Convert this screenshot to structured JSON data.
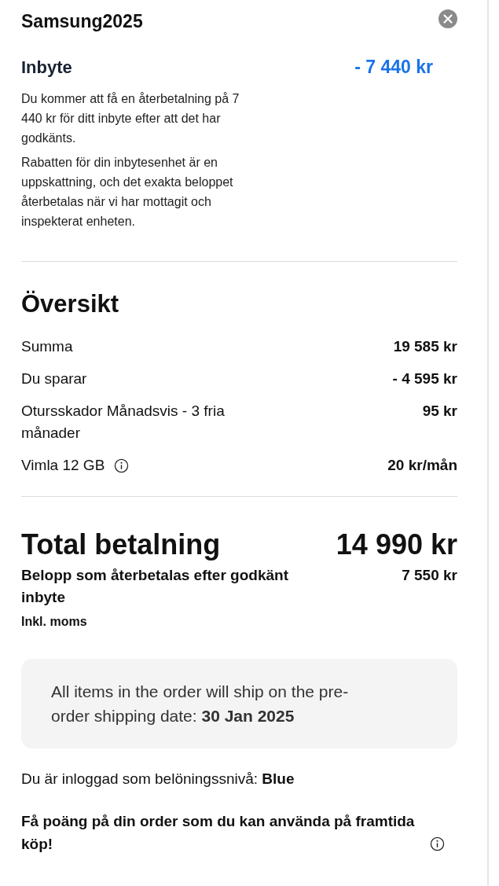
{
  "header": {
    "title": "Samsung2025"
  },
  "trade_in": {
    "title": "Inbyte",
    "amount": "- 7 440 kr",
    "paragraphs": [
      "Du kommer att få en återbetalning på 7 440 kr för ditt inbyte efter att det har godkänts.",
      "Rabatten för din inbytesenhet är en uppskattning, och det exakta beloppet återbetalas när vi har mottagit och inspekterat enheten."
    ]
  },
  "overview": {
    "title": "Översikt",
    "rows": [
      {
        "label": "Summa",
        "value": "19 585 kr",
        "info": false
      },
      {
        "label": "Du sparar",
        "value": "- 4 595 kr",
        "info": false
      },
      {
        "label": "Otursskador Månadsvis - 3 fria månader",
        "value": "95 kr",
        "info": false
      },
      {
        "label": "Vimla 12 GB",
        "value": "20 kr/mån",
        "info": true
      }
    ]
  },
  "total": {
    "label": "Total betalning",
    "value": "14 990 kr",
    "refund_label": "Belopp som återbetalas efter godkänt inbyte",
    "refund_value": "7 550 kr",
    "vat_note": "Inkl. moms"
  },
  "shipping_notice": "All items in the order will ship on the pre-order shipping date: **30 Jan 2025**",
  "rewards": {
    "level_text": "Du är inloggad som belöningssnivå: **Blue**",
    "points_text": "Få poäng på din order som du kan använda på framtida köp!",
    "info": true
  }
}
